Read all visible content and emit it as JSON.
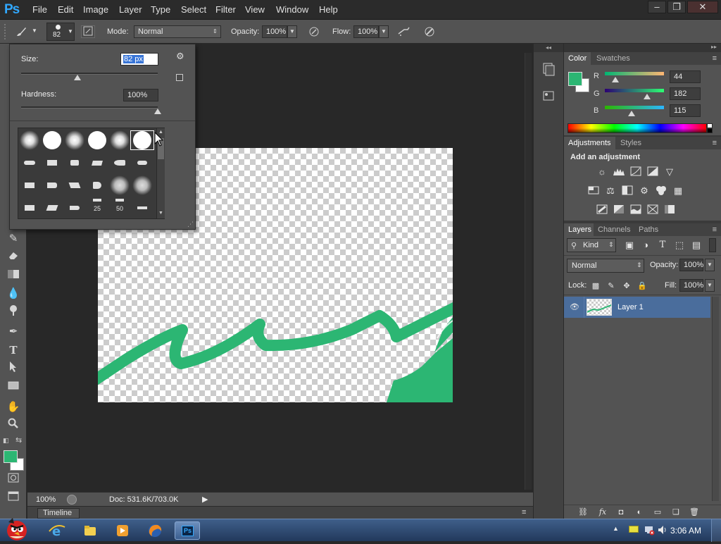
{
  "app": {
    "logo": "Ps"
  },
  "menu": [
    "File",
    "Edit",
    "Image",
    "Layer",
    "Type",
    "Select",
    "Filter",
    "View",
    "Window",
    "Help"
  ],
  "window_controls": {
    "minimize": "–",
    "restore": "❐",
    "close": "✕"
  },
  "options": {
    "brush_size": "82",
    "mode_label": "Mode:",
    "mode_value": "Normal",
    "opacity_label": "Opacity:",
    "opacity_value": "100%",
    "flow_label": "Flow:",
    "flow_value": "100%"
  },
  "brush_popup": {
    "size_label": "Size:",
    "size_value": "82 px",
    "size_slider_percent": 41,
    "hardness_label": "Hardness:",
    "hardness_value": "100%",
    "hardness_slider_percent": 100,
    "preset_numbers": [
      "25",
      "50"
    ]
  },
  "status": {
    "zoom": "100%",
    "doc": "Doc: 531.6K/703.0K"
  },
  "timeline": {
    "label": "Timeline"
  },
  "color_panel": {
    "tabs": [
      "Color",
      "Swatches"
    ],
    "r_label": "R",
    "r_value": "44",
    "g_label": "G",
    "g_value": "182",
    "b_label": "B",
    "b_value": "115",
    "foreground": "#2cb673",
    "background": "#ffffff"
  },
  "adjustments_panel": {
    "tabs": [
      "Adjustments",
      "Styles"
    ],
    "heading": "Add an adjustment"
  },
  "layers_panel": {
    "tabs": [
      "Layers",
      "Channels",
      "Paths"
    ],
    "filter_kind": "Kind",
    "blend_mode": "Normal",
    "opacity_label": "Opacity:",
    "opacity_value": "100%",
    "lock_label": "Lock:",
    "fill_label": "Fill:",
    "fill_value": "100%",
    "layers": [
      {
        "name": "Layer 1"
      }
    ]
  },
  "taskbar": {
    "time": "3:06 AM"
  },
  "colors": {
    "accent_green": "#2cb673",
    "panel_gray": "#535353",
    "workspace": "#282828",
    "highlight_blue": "#4a6d9c"
  }
}
